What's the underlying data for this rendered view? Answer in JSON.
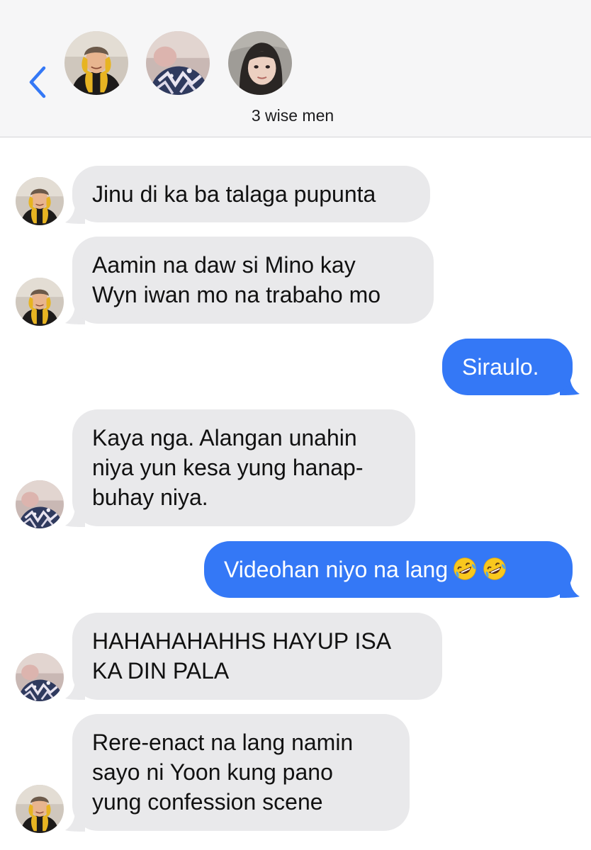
{
  "header": {
    "back_icon": "chevron-left-icon",
    "group_name": "3 wise men",
    "avatars": [
      "avatar-yellow-hoodie",
      "avatar-blurry-patterned",
      "avatar-person-face"
    ]
  },
  "colors": {
    "accent": "#3478f6",
    "incoming_bubble": "#e9e9eb",
    "header_bg": "#f6f6f7"
  },
  "messages": [
    {
      "direction": "incoming",
      "sender_avatar": "avatar-yellow-hoodie",
      "lines": [
        "Jinu di ka ba talaga pupunta"
      ]
    },
    {
      "direction": "incoming",
      "sender_avatar": "avatar-yellow-hoodie",
      "lines": [
        "Aamin na daw si Mino kay",
        "Wyn iwan mo na trabaho mo"
      ]
    },
    {
      "direction": "outgoing",
      "lines": [
        "Siraulo."
      ]
    },
    {
      "direction": "incoming",
      "sender_avatar": "avatar-blurry-patterned",
      "lines": [
        "Kaya nga. Alangan unahin",
        "niya yun kesa yung hanap-",
        "buhay niya."
      ]
    },
    {
      "direction": "outgoing",
      "lines": [
        "Videohan niyo na lang"
      ],
      "emoji": [
        "rolling-on-floor-laughing-emoji",
        "rolling-on-floor-laughing-emoji"
      ]
    },
    {
      "direction": "incoming",
      "sender_avatar": "avatar-blurry-patterned",
      "lines": [
        "HAHAHAHAHHS HAYUP ISA",
        "KA DIN PALA"
      ]
    },
    {
      "direction": "incoming",
      "sender_avatar": "avatar-yellow-hoodie",
      "lines": [
        "Rere-enact na lang namin",
        "sayo ni Yoon kung pano",
        "yung confession scene"
      ]
    }
  ]
}
